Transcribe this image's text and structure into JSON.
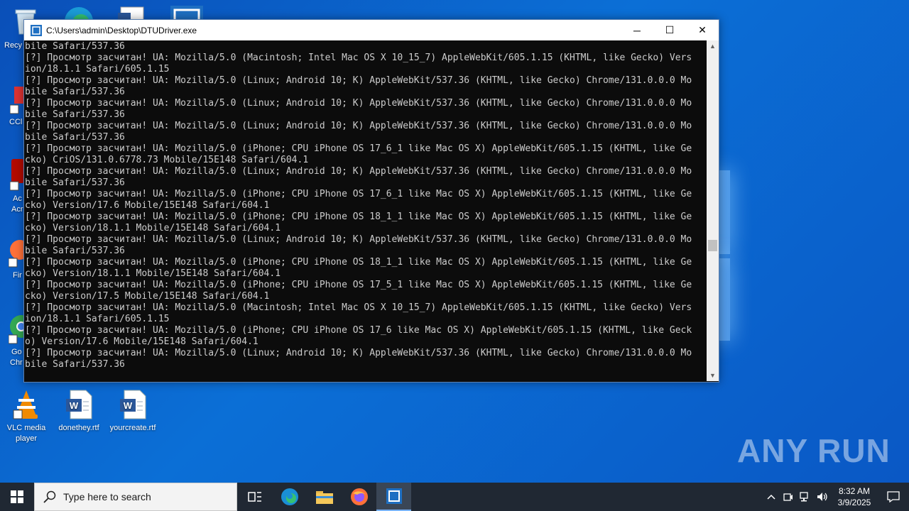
{
  "desktop": {
    "icons": [
      {
        "label_line1": "VLC media",
        "label_line2": "player",
        "icon": "vlc-icon"
      },
      {
        "label_line1": "donethey.rtf",
        "label_line2": "",
        "icon": "word-doc-icon"
      },
      {
        "label_line1": "yourcreate.rtf",
        "label_line2": "",
        "icon": "word-doc-icon"
      }
    ],
    "partial_labels": [
      "Recy",
      "CCl",
      "Ac",
      "Acr",
      "Fir",
      "Go",
      "Chr"
    ]
  },
  "console": {
    "title": "C:\\Users\\admin\\Desktop\\DTUDriver.exe",
    "controls": {
      "minimize": "─",
      "maximize": "☐",
      "close": "✕"
    },
    "lines": [
      "bile Safari/537.36",
      "[?] Просмотр засчитан! UA: Mozilla/5.0 (Macintosh; Intel Mac OS X 10_15_7) AppleWebKit/605.1.15 (KHTML, like Gecko) Vers",
      "ion/18.1.1 Safari/605.1.15",
      "[?] Просмотр засчитан! UA: Mozilla/5.0 (Linux; Android 10; K) AppleWebKit/537.36 (KHTML, like Gecko) Chrome/131.0.0.0 Mo",
      "bile Safari/537.36",
      "[?] Просмотр засчитан! UA: Mozilla/5.0 (Linux; Android 10; K) AppleWebKit/537.36 (KHTML, like Gecko) Chrome/131.0.0.0 Mo",
      "bile Safari/537.36",
      "[?] Просмотр засчитан! UA: Mozilla/5.0 (Linux; Android 10; K) AppleWebKit/537.36 (KHTML, like Gecko) Chrome/131.0.0.0 Mo",
      "bile Safari/537.36",
      "[?] Просмотр засчитан! UA: Mozilla/5.0 (iPhone; CPU iPhone OS 17_6_1 like Mac OS X) AppleWebKit/605.1.15 (KHTML, like Ge",
      "cko) CriOS/131.0.6778.73 Mobile/15E148 Safari/604.1",
      "[?] Просмотр засчитан! UA: Mozilla/5.0 (Linux; Android 10; K) AppleWebKit/537.36 (KHTML, like Gecko) Chrome/131.0.0.0 Mo",
      "bile Safari/537.36",
      "[?] Просмотр засчитан! UA: Mozilla/5.0 (iPhone; CPU iPhone OS 17_6_1 like Mac OS X) AppleWebKit/605.1.15 (KHTML, like Ge",
      "cko) Version/17.6 Mobile/15E148 Safari/604.1",
      "[?] Просмотр засчитан! UA: Mozilla/5.0 (iPhone; CPU iPhone OS 18_1_1 like Mac OS X) AppleWebKit/605.1.15 (KHTML, like Ge",
      "cko) Version/18.1.1 Mobile/15E148 Safari/604.1",
      "[?] Просмотр засчитан! UA: Mozilla/5.0 (Linux; Android 10; K) AppleWebKit/537.36 (KHTML, like Gecko) Chrome/131.0.0.0 Mo",
      "bile Safari/537.36",
      "[?] Просмотр засчитан! UA: Mozilla/5.0 (iPhone; CPU iPhone OS 18_1_1 like Mac OS X) AppleWebKit/605.1.15 (KHTML, like Ge",
      "cko) Version/18.1.1 Mobile/15E148 Safari/604.1",
      "[?] Просмотр засчитан! UA: Mozilla/5.0 (iPhone; CPU iPhone OS 17_5_1 like Mac OS X) AppleWebKit/605.1.15 (KHTML, like Ge",
      "cko) Version/17.5 Mobile/15E148 Safari/604.1",
      "[?] Просмотр засчитан! UA: Mozilla/5.0 (Macintosh; Intel Mac OS X 10_15_7) AppleWebKit/605.1.15 (KHTML, like Gecko) Vers",
      "ion/18.1.1 Safari/605.1.15",
      "[?] Просмотр засчитан! UA: Mozilla/5.0 (iPhone; CPU iPhone OS 17_6 like Mac OS X) AppleWebKit/605.1.15 (KHTML, like Geck",
      "o) Version/17.6 Mobile/15E148 Safari/604.1",
      "[?] Просмотр засчитан! UA: Mozilla/5.0 (Linux; Android 10; K) AppleWebKit/537.36 (KHTML, like Gecko) Chrome/131.0.0.0 Mo",
      "bile Safari/537.36"
    ]
  },
  "taskbar": {
    "search_placeholder": "Type here to search",
    "pinned": [
      "task-view-icon",
      "edge-icon",
      "file-explorer-icon",
      "firefox-icon",
      "console-app-icon"
    ],
    "clock_time": "8:32 AM",
    "clock_date": "3/9/2025"
  },
  "watermark": "ANY RUN"
}
